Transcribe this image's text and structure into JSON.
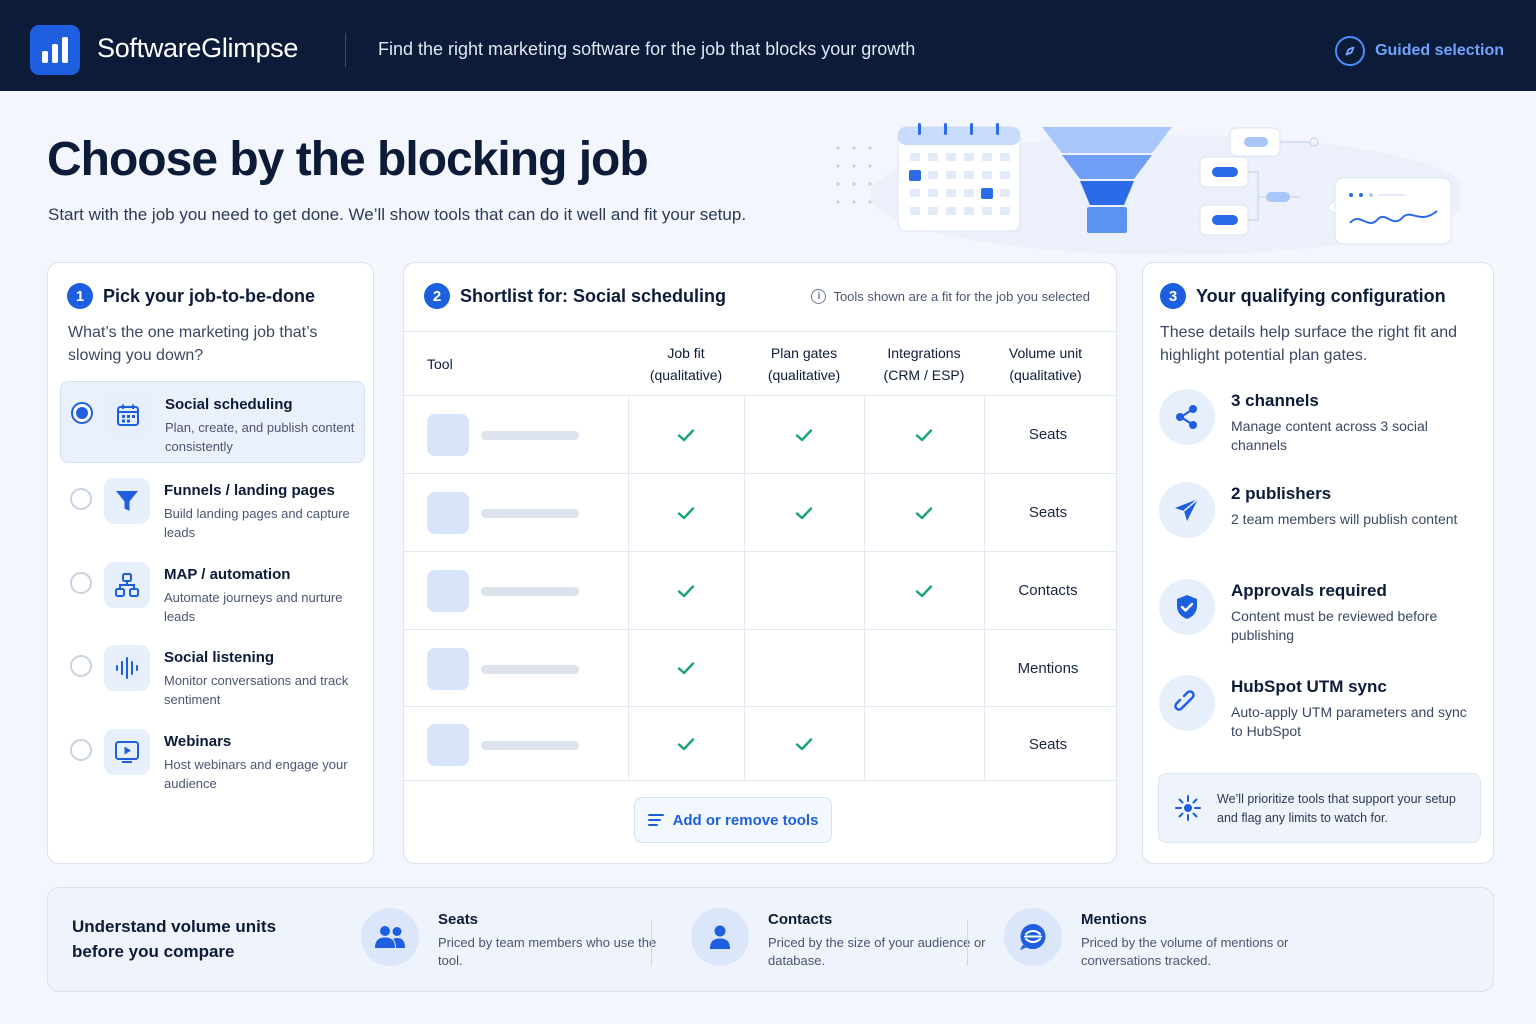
{
  "header": {
    "brand": "SoftwareGlimpse",
    "tagline": "Find the right marketing software for the job that blocks your growth",
    "guided_label": "Guided selection"
  },
  "hero": {
    "title": "Choose by the blocking job",
    "subtitle": "Start with the job you need to get done. We’ll show tools that can do it well and fit your setup."
  },
  "step1": {
    "number": "1",
    "title": "Pick your job-to-be-done",
    "question": "What’s the one marketing job that’s slowing you down?",
    "jobs": [
      {
        "title": "Social scheduling",
        "desc": "Plan, create, and publish content consistently",
        "selected": true,
        "icon": "calendar-icon"
      },
      {
        "title": "Funnels / landing pages",
        "desc": "Build landing pages and capture leads",
        "selected": false,
        "icon": "funnel-icon"
      },
      {
        "title": "MAP / automation",
        "desc": "Automate journeys and nurture leads",
        "selected": false,
        "icon": "workflow-icon"
      },
      {
        "title": "Social listening",
        "desc": "Monitor conversations and track sentiment",
        "selected": false,
        "icon": "soundwave-icon"
      },
      {
        "title": "Webinars",
        "desc": "Host webinars and engage your audience",
        "selected": false,
        "icon": "video-play-icon"
      }
    ]
  },
  "step2": {
    "number": "2",
    "title": "Shortlist for: Social scheduling",
    "note": "Tools shown are a fit for the job you selected",
    "columns": {
      "tool": "Tool",
      "job_fit": "Job fit",
      "job_fit_sub": "(qualitative)",
      "plan_gates": "Plan gates",
      "plan_gates_sub": "(qualitative)",
      "integrations": "Integrations",
      "integrations_sub": "(CRM / ESP)",
      "volume_unit": "Volume unit",
      "volume_unit_sub": "(qualitative)"
    },
    "rows": [
      {
        "job_fit": true,
        "plan_gates": true,
        "integrations": true,
        "volume_unit": "Seats"
      },
      {
        "job_fit": true,
        "plan_gates": true,
        "integrations": true,
        "volume_unit": "Seats"
      },
      {
        "job_fit": true,
        "plan_gates": false,
        "integrations": true,
        "volume_unit": "Contacts"
      },
      {
        "job_fit": true,
        "plan_gates": false,
        "integrations": false,
        "volume_unit": "Mentions"
      },
      {
        "job_fit": true,
        "plan_gates": true,
        "integrations": false,
        "volume_unit": "Seats"
      }
    ],
    "add_button": "Add or remove tools"
  },
  "step3": {
    "number": "3",
    "title": "Your qualifying configuration",
    "intro": "These details help surface the right fit and highlight potential plan gates.",
    "items": [
      {
        "title": "3 channels",
        "desc": "Manage content across 3 social channels",
        "icon": "share-icon"
      },
      {
        "title": "2 publishers",
        "desc": "2 team members will publish content",
        "icon": "paper-plane-icon"
      },
      {
        "title": "Approvals required",
        "desc": "Content must be reviewed before publishing",
        "icon": "shield-check-icon"
      },
      {
        "title": "HubSpot UTM sync",
        "desc": "Auto-apply UTM parameters and sync to HubSpot",
        "icon": "link-icon"
      }
    ],
    "footnote": "We’ll prioritize tools that support your setup and flag any limits to watch for."
  },
  "volume_units": {
    "title": "Understand volume units before you compare",
    "units": [
      {
        "title": "Seats",
        "desc": "Priced by team members who use the tool.",
        "icon": "users-icon"
      },
      {
        "title": "Contacts",
        "desc": "Priced by the size of your audience or database.",
        "icon": "user-icon"
      },
      {
        "title": "Mentions",
        "desc": "Priced by the volume of mentions or conversations tracked.",
        "icon": "chat-bubble-icon"
      }
    ]
  },
  "colors": {
    "header_bg": "#0c1b38",
    "accent": "#1e5fe0",
    "check": "#1aa37a",
    "page_bg": "#f3f6fc"
  }
}
